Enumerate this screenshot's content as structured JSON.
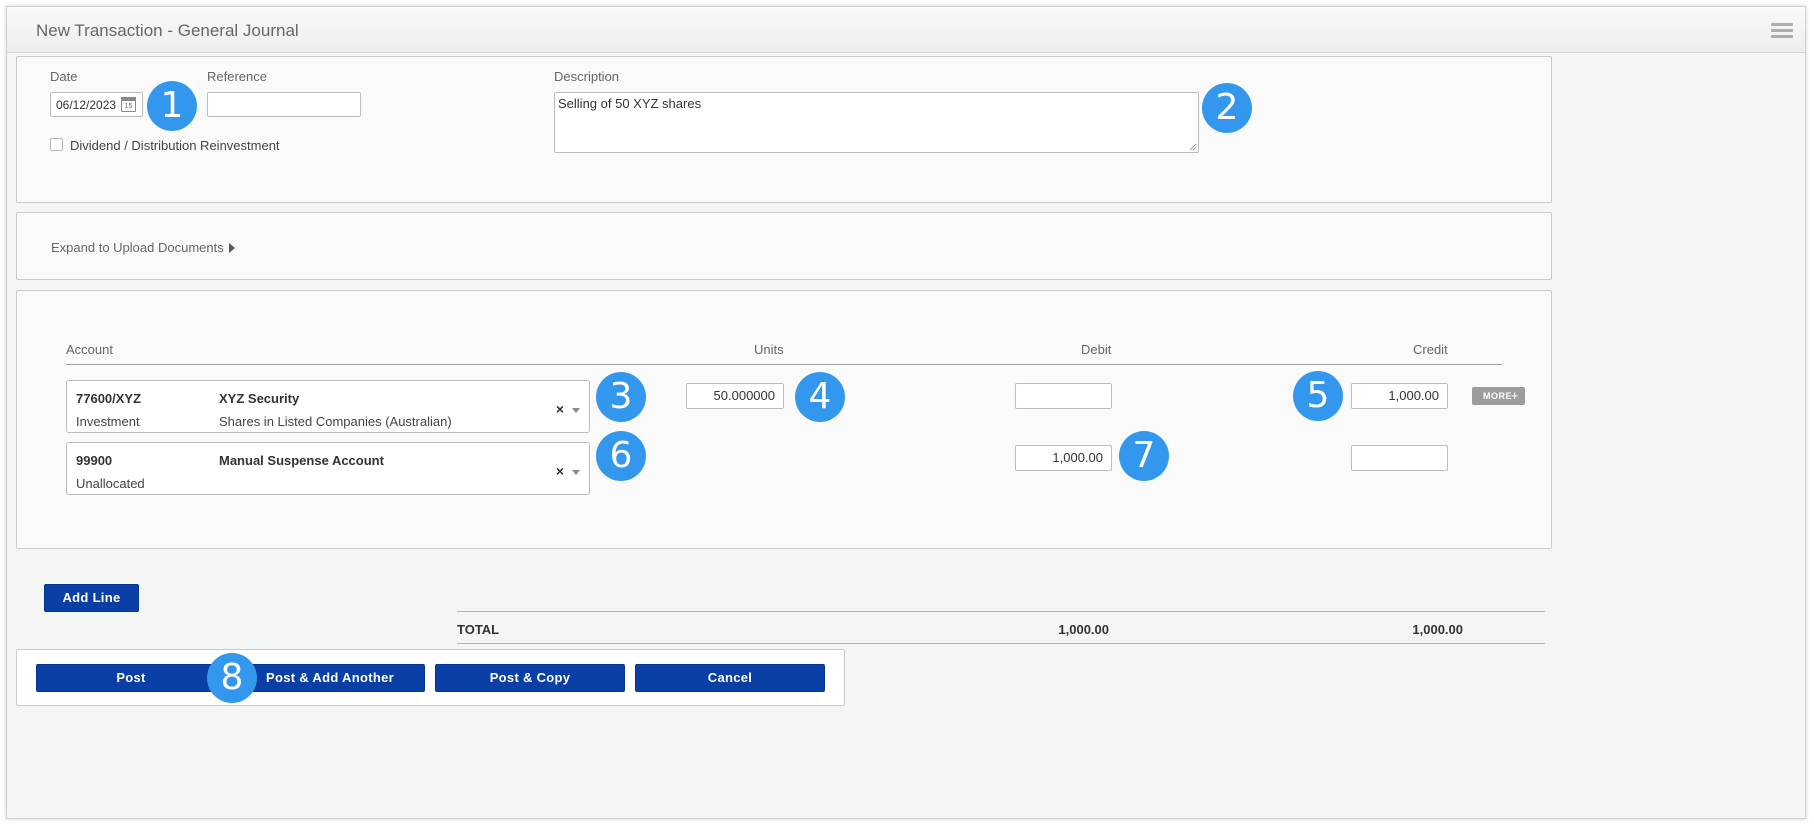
{
  "window": {
    "title": "New Transaction - General Journal",
    "menu_icon": "hamburger-menu-icon"
  },
  "header_form": {
    "date_label": "Date",
    "date_value": "06/12/2023",
    "calendar_icon": "calendar-icon",
    "calendar_day": "15",
    "reference_label": "Reference",
    "reference_value": "",
    "description_label": "Description",
    "description_value": "Selling of 50 XYZ shares",
    "reinvestment_label": "Dividend / Distribution Reinvestment",
    "reinvestment_checked": false
  },
  "upload": {
    "expand_label": "Expand to Upload Documents"
  },
  "lines": {
    "headers": {
      "account": "Account",
      "units": "Units",
      "debit": "Debit",
      "credit": "Credit"
    },
    "rows": [
      {
        "code": "77600/XYZ",
        "type": "Investment",
        "name": "XYZ Security",
        "description": "Shares in Listed Companies (Australian)",
        "units": "50.000000",
        "debit": "",
        "credit": "1,000.00",
        "more_label": "MORE"
      },
      {
        "code": "99900",
        "type": "Unallocated",
        "name": "Manual Suspense Account",
        "description": "",
        "debit": "1,000.00",
        "credit": ""
      }
    ]
  },
  "add_line_label": "Add Line",
  "totals": {
    "label": "TOTAL",
    "debit": "1,000.00",
    "credit": "1,000.00"
  },
  "actions": {
    "post": "Post",
    "post_add_another": "Post & Add Another",
    "post_copy": "Post & Copy",
    "cancel": "Cancel"
  },
  "callouts": [
    "1",
    "2",
    "3",
    "4",
    "5",
    "6",
    "7",
    "8"
  ],
  "colors": {
    "primary_button": "#0a3fa6",
    "callout": "#3497ee"
  }
}
